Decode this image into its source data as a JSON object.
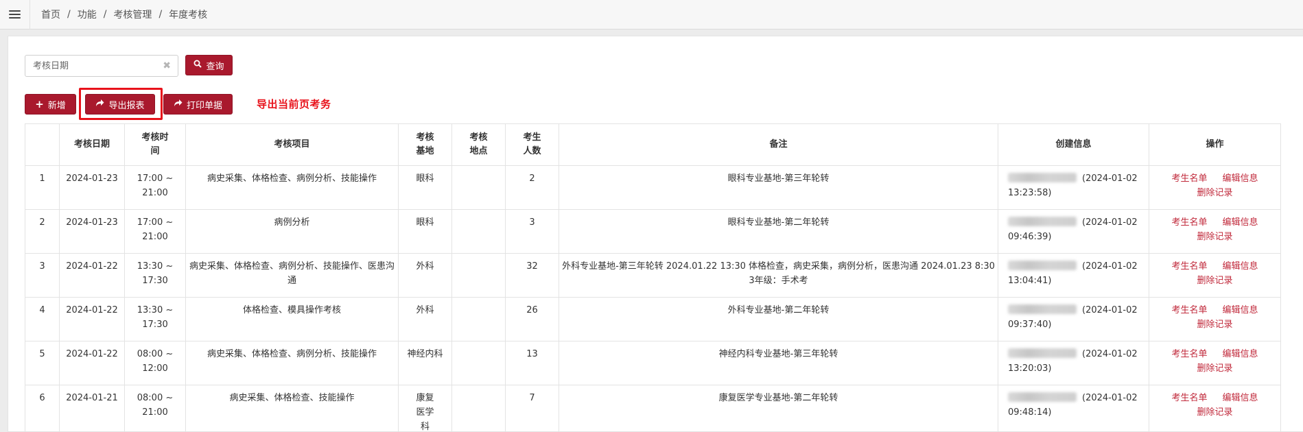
{
  "breadcrumb": [
    "首页",
    "功能",
    "考核管理",
    "年度考核"
  ],
  "search": {
    "placeholder": "考核日期",
    "button_label": "查询"
  },
  "toolbar": {
    "add_label": "新增",
    "export_label": "导出报表",
    "print_label": "打印单据"
  },
  "annotation": "导出当前页考务",
  "columns": [
    "",
    "考核日期",
    "考核时间",
    "考核项目",
    "考核基地",
    "考核地点",
    "考生人数",
    "备注",
    "创建信息",
    "操作"
  ],
  "ops_labels": {
    "students": "考生名单",
    "edit": "编辑信息",
    "delete": "删除记录"
  },
  "rows": [
    {
      "no": "1",
      "date": "2024-01-23",
      "time1": "17:00 ~",
      "time2": "21:00",
      "items": "病史采集、体格检查、病例分析、技能操作",
      "base": "眼科",
      "place": "",
      "count": "2",
      "remark": "眼科专业基地-第三年轮转",
      "created1": "(2024-01-02",
      "created2": "13:23:58)"
    },
    {
      "no": "2",
      "date": "2024-01-23",
      "time1": "17:00 ~",
      "time2": "21:00",
      "items": "病例分析",
      "base": "眼科",
      "place": "",
      "count": "3",
      "remark": "眼科专业基地-第二年轮转",
      "created1": "(2024-01-02",
      "created2": "09:46:39)"
    },
    {
      "no": "3",
      "date": "2024-01-22",
      "time1": "13:30 ~",
      "time2": "17:30",
      "items": "病史采集、体格检查、病例分析、技能操作、医患沟通",
      "base": "外科",
      "place": "",
      "count": "32",
      "remark": "外科专业基地-第三年轮转 2024.01.22 13:30 体格检查，病史采集，病例分析，医患沟通 2024.01.23 8:30 3年级：手术考",
      "created1": "(2024-01-02",
      "created2": "13:04:41)"
    },
    {
      "no": "4",
      "date": "2024-01-22",
      "time1": "13:30 ~",
      "time2": "17:30",
      "items": "体格检查、模具操作考核",
      "base": "外科",
      "place": "",
      "count": "26",
      "remark": "外科专业基地-第二年轮转",
      "created1": "(2024-01-02",
      "created2": "09:37:40)"
    },
    {
      "no": "5",
      "date": "2024-01-22",
      "time1": "08:00 ~",
      "time2": "12:00",
      "items": "病史采集、体格检查、病例分析、技能操作",
      "base": "神经内科",
      "place": "",
      "count": "13",
      "remark": "神经内科专业基地-第三年轮转",
      "created1": "(2024-01-02",
      "created2": "13:20:03)"
    },
    {
      "no": "6",
      "date": "2024-01-21",
      "time1": "08:00 ~",
      "time2": "21:00",
      "items": "病史采集、体格检查、技能操作",
      "base": "康复医学科",
      "place": "",
      "count": "7",
      "remark": "康复医学专业基地-第二年轮转",
      "created1": "(2024-01-02",
      "created2": "09:48:14)"
    }
  ]
}
